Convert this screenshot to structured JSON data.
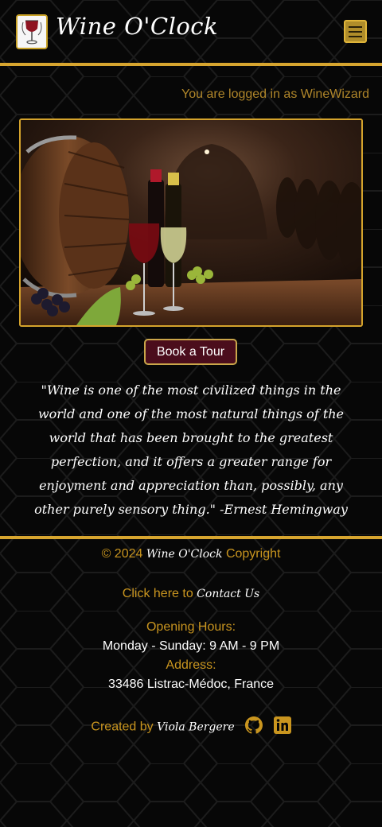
{
  "header": {
    "brand": "Wine O'Clock",
    "menu_icon": "hamburger-menu-icon",
    "logo_icon": "wine-glass-logo-icon"
  },
  "user": {
    "status": "You are logged in as WineWizard"
  },
  "hero": {
    "image": "wine-cellar-barrel-photo"
  },
  "cta": {
    "label": "Book a Tour"
  },
  "quote": {
    "text": "\"Wine is one of the most civilized things in the world and one of the most natural things of the world that has been brought to the greatest perfection, and it offers a greater range for enjoyment and appreciation than, possibly, any other purely sensory thing.\" -Ernest Hemingway"
  },
  "footer": {
    "copyright_prefix": "© 2024",
    "copyright_brand": "Wine O'Clock",
    "copyright_suffix": "Copyright",
    "contact_prefix": "Click here to",
    "contact_link": "Contact Us",
    "hours_label": "Opening Hours:",
    "hours_value": "Monday - Sunday: 9 AM - 9 PM",
    "address_label": "Address:",
    "address_value": "33486 Listrac-Médoc, France",
    "credit_prefix": "Created by",
    "credit_name": "Viola Bergere",
    "social_icons": [
      "github-icon",
      "linkedin-icon"
    ]
  },
  "colors": {
    "accent_gold": "#d7a52f",
    "text_gold": "#c9951f",
    "button_burgundy": "#4b0d1c",
    "background": "#070707"
  }
}
